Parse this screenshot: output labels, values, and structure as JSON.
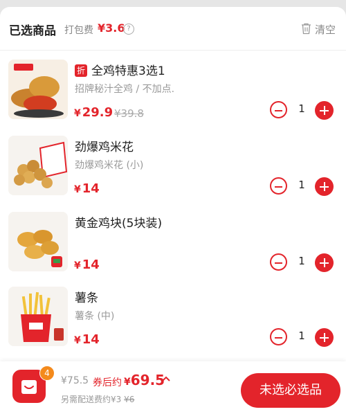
{
  "header": {
    "title": "已选商品",
    "pack_fee_label": "打包费",
    "pack_fee": "¥3.6",
    "help_icon": "?",
    "clear_label": "清空"
  },
  "items": [
    {
      "tag": "折",
      "name": "全鸡特惠3选1",
      "spec": "招牌秘汁全鸡 / 不加点.",
      "price": "29.9",
      "original_price": "¥39.8",
      "quantity": "1"
    },
    {
      "name": "劲爆鸡米花",
      "spec": "劲爆鸡米花 (小)",
      "price": "14",
      "quantity": "1"
    },
    {
      "name": "黄金鸡块(5块装)",
      "spec": "",
      "price": "14",
      "quantity": "1"
    },
    {
      "name": "薯条",
      "spec": "薯条 (中)",
      "price": "14",
      "quantity": "1"
    }
  ],
  "currency": "¥",
  "footer": {
    "cart_count": "4",
    "total_original": "¥75.5",
    "coupon_label": "券后约",
    "total_price": "69.5",
    "delivery_note_prefix": "另需配送费约¥3",
    "delivery_note_strike": "¥6",
    "submit_label": "未选必选品"
  },
  "colors": {
    "accent": "#e3242b",
    "badge": "#f48a1c"
  }
}
